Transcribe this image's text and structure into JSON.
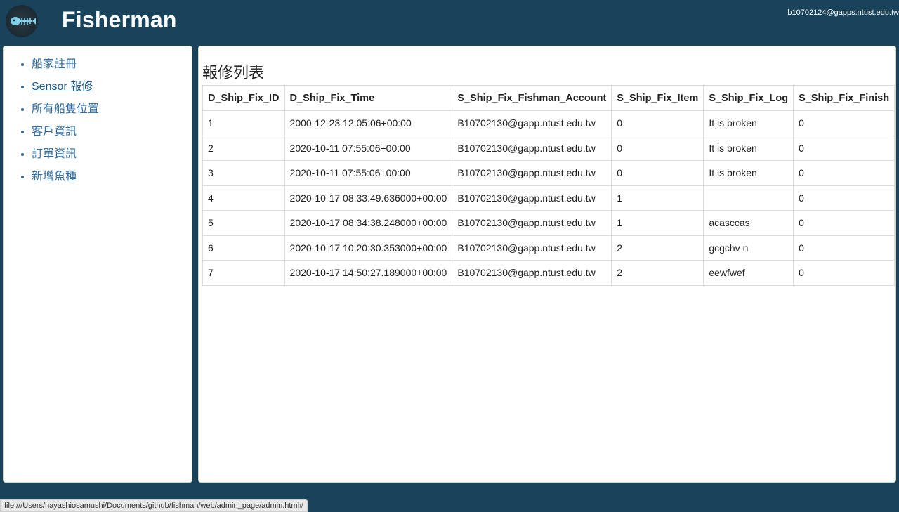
{
  "header": {
    "title": "Fisherman",
    "user_email": "b10702124@gapps.ntust.edu.tw",
    "logo_icon": "fish-skeleton-icon"
  },
  "sidebar": {
    "items": [
      {
        "label": "船家註冊"
      },
      {
        "label": "Sensor 報修",
        "active": true
      },
      {
        "label": "所有船隻位置"
      },
      {
        "label": "客戶資訊"
      },
      {
        "label": "訂單資訊"
      },
      {
        "label": "新增魚種"
      }
    ]
  },
  "main": {
    "title": "報修列表",
    "columns": [
      "D_Ship_Fix_ID",
      "D_Ship_Fix_Time",
      "S_Ship_Fix_Fishman_Account",
      "S_Ship_Fix_Item",
      "S_Ship_Fix_Log",
      "S_Ship_Fix_Finish"
    ],
    "rows": [
      [
        "1",
        "2000-12-23 12:05:06+00:00",
        "B10702130@gapp.ntust.edu.tw",
        "0",
        "It is broken",
        "0"
      ],
      [
        "2",
        "2020-10-11 07:55:06+00:00",
        "B10702130@gapp.ntust.edu.tw",
        "0",
        "It is broken",
        "0"
      ],
      [
        "3",
        "2020-10-11 07:55:06+00:00",
        "B10702130@gapp.ntust.edu.tw",
        "0",
        "It is broken",
        "0"
      ],
      [
        "4",
        "2020-10-17 08:33:49.636000+00:00",
        "B10702130@gapp.ntust.edu.tw",
        "1",
        "",
        "0"
      ],
      [
        "5",
        "2020-10-17 08:34:38.248000+00:00",
        "B10702130@gapp.ntust.edu.tw",
        "1",
        "acasccas",
        "0"
      ],
      [
        "6",
        "2020-10-17 10:20:30.353000+00:00",
        "B10702130@gapp.ntust.edu.tw",
        "2",
        "gcgchv n",
        "0"
      ],
      [
        "7",
        "2020-10-17 14:50:27.189000+00:00",
        "B10702130@gapp.ntust.edu.tw",
        "2",
        "eewfwef",
        "0"
      ]
    ]
  },
  "status_bar": {
    "url": "file:///Users/hayashiosamushi/Documents/github/fishman/web/admin_page/admin.html#"
  },
  "colors": {
    "background": "#18435a",
    "link": "#2e6da4",
    "panel": "#ffffff"
  }
}
